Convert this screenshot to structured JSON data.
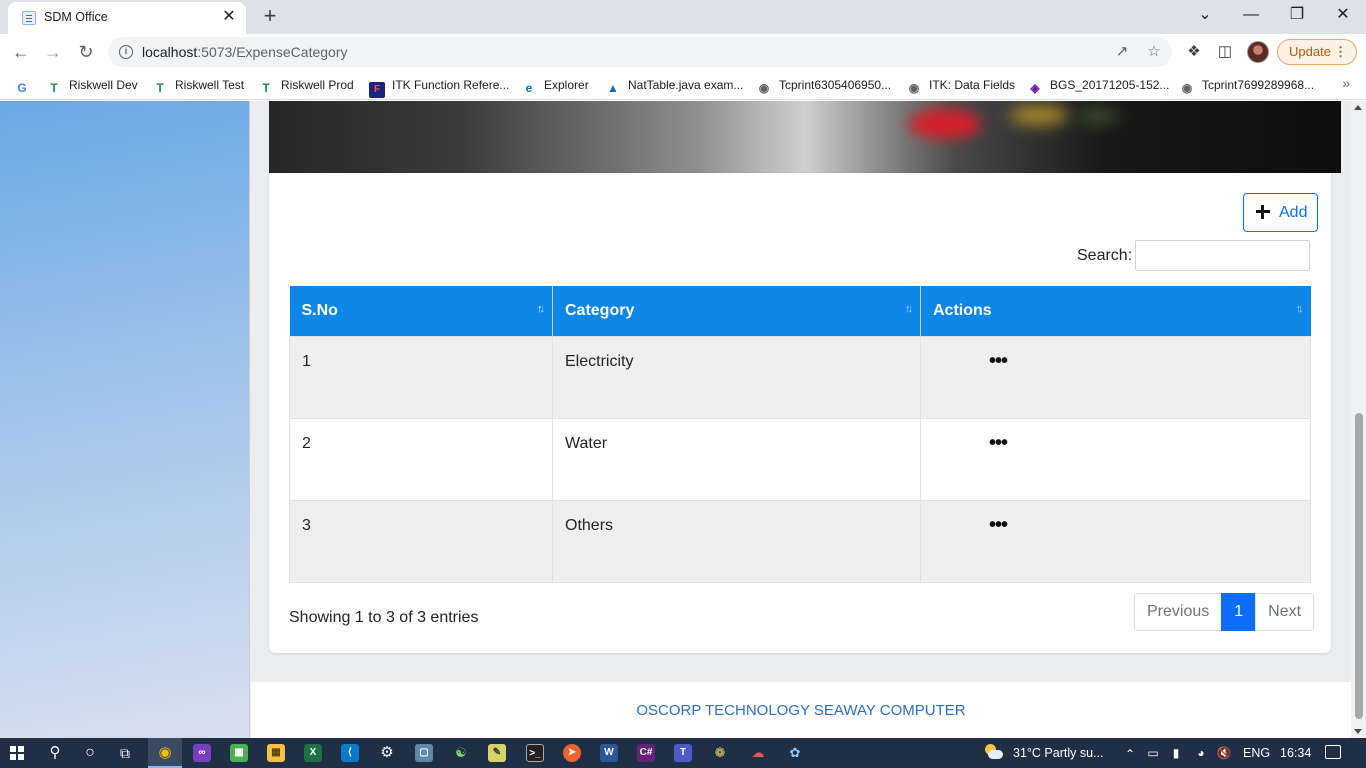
{
  "browser": {
    "tab_title": "SDM Office",
    "tab_close": "✕",
    "new_tab": "+",
    "window_controls": {
      "dropdown": "⌄",
      "minimize": "—",
      "restore": "❐",
      "close": "✕"
    },
    "url_host": "localhost",
    "url_path": ":5073/ExpenseCategory",
    "update_label": "Update",
    "update_dots": "⋮",
    "icons": {
      "back": "back-arrow-icon",
      "forward": "forward-arrow-icon",
      "reload": "reload-icon",
      "info": "info-icon",
      "share": "share-icon",
      "star": "star-icon",
      "extensions": "puzzle-icon",
      "side_panel": "side-panel-icon"
    }
  },
  "bookmarks": [
    {
      "label": "",
      "icon": "G"
    },
    {
      "label": "Riskwell Dev",
      "icon": "T"
    },
    {
      "label": "Riskwell Test",
      "icon": "T"
    },
    {
      "label": "Riskwell Prod",
      "icon": "T"
    },
    {
      "label": "ITK Function Refere...",
      "icon": "F"
    },
    {
      "label": "Explorer",
      "icon": "e"
    },
    {
      "label": "NatTable.java exam...",
      "icon": "▲"
    },
    {
      "label": "Tcprint6305406950...",
      "icon": "◉"
    },
    {
      "label": "ITK: Data Fields",
      "icon": "◉"
    },
    {
      "label": "BGS_20171205-152...",
      "icon": "◈"
    },
    {
      "label": "Tcprint7699289968...",
      "icon": "◉"
    }
  ],
  "bookmarks_more": "»",
  "content": {
    "add_label": "Add",
    "search_label": "Search:",
    "search_value": "",
    "table": {
      "headers": [
        "S.No",
        "Category",
        "Actions"
      ],
      "rows": [
        {
          "sno": "1",
          "category": "Electricity",
          "actions": "•••"
        },
        {
          "sno": "2",
          "category": "Water",
          "actions": "•••"
        },
        {
          "sno": "3",
          "category": "Others",
          "actions": "•••"
        }
      ]
    },
    "showing_text": "Showing 1 to 3 of 3 entries",
    "pagination": {
      "previous": "Previous",
      "current": "1",
      "next": "Next"
    }
  },
  "footer": {
    "text": "OSCORP TECHNOLOGY  SEAWAY COMPUTER"
  },
  "taskbar": {
    "weather": "31°C  Partly su...",
    "language": "ENG",
    "time": "16:34"
  },
  "colors": {
    "primary": "#0d6efd",
    "table_header": "#0d86e8",
    "footer_link": "#2d6fc1",
    "taskbar": "#1f2f45"
  }
}
